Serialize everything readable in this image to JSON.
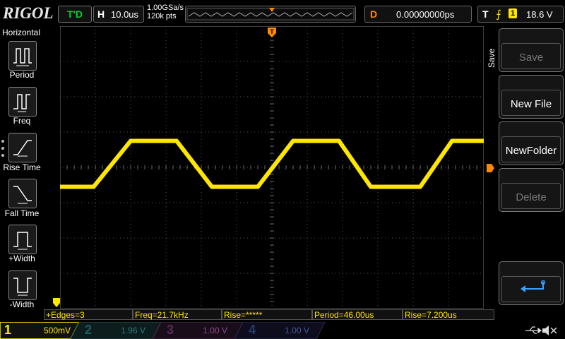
{
  "header": {
    "logo": "RIGOL",
    "run_status": "T'D",
    "horizontal": {
      "label": "H",
      "value": "10.0us"
    },
    "sample_rate": "1.00GSa/s",
    "memory_depth": "120k pts",
    "delay": {
      "label": "D",
      "value": "0.00000000ps"
    },
    "trigger": {
      "label": "T",
      "edge_symbol": "⨍",
      "source": "1",
      "level": "18.6 V"
    }
  },
  "left_menu": {
    "title": "Horizontal",
    "items": [
      {
        "label": "Period",
        "icon": "period-icon"
      },
      {
        "label": "Freq",
        "icon": "freq-icon"
      },
      {
        "label": "Rise Time",
        "icon": "rise-time-icon"
      },
      {
        "label": "Fall Time",
        "icon": "fall-time-icon"
      },
      {
        "label": "+Width",
        "icon": "positive-width-icon"
      },
      {
        "label": "-Width",
        "icon": "negative-width-icon"
      }
    ]
  },
  "right_menu": {
    "title": "Save",
    "buttons": [
      {
        "label": "Save",
        "enabled": false
      },
      {
        "label": "New File",
        "enabled": true
      },
      {
        "label": "NewFolder",
        "enabled": true
      },
      {
        "label": "Delete",
        "enabled": false
      }
    ],
    "return_icon": "return-arrow-icon"
  },
  "measurements": [
    "+Edges=3",
    "Freq=21.7kHz",
    "Rise=*****",
    "Period=46.00us",
    "Rise=7.200us"
  ],
  "channels": [
    {
      "num": "1",
      "value": "500mV",
      "color": "#ffe600",
      "active": true
    },
    {
      "num": "2",
      "value": "1.96 V",
      "color": "#00b7c3",
      "active": false
    },
    {
      "num": "3",
      "value": "1.00 V",
      "color": "#c040c0",
      "active": false
    },
    {
      "num": "4",
      "value": "1.00 V",
      "color": "#3a6cff",
      "active": false
    }
  ],
  "markers": {
    "trigger_pos": "T"
  },
  "colors": {
    "trace": "#ffe600",
    "trigger": "#ff8a00",
    "grid": "#555555"
  },
  "chart_data": {
    "type": "line",
    "description_units": "divisions",
    "x_range_div": [
      0,
      12
    ],
    "y_range_div": [
      -4,
      4
    ],
    "series": [
      {
        "x": [
          0,
          0.95,
          2.0,
          3.3,
          4.3,
          5.6,
          6.6,
          7.9,
          8.8,
          10.2,
          11.1,
          12.0
        ],
        "y": [
          -0.55,
          -0.55,
          0.75,
          0.75,
          -0.55,
          -0.55,
          0.75,
          0.75,
          -0.55,
          -0.55,
          0.75,
          0.75
        ]
      }
    ]
  }
}
